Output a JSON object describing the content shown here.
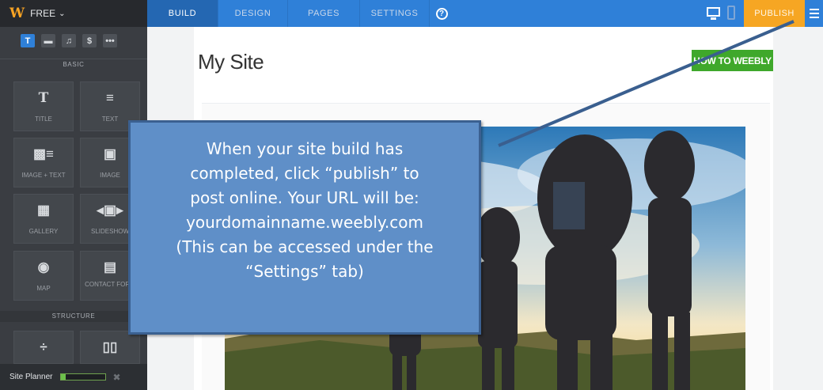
{
  "brand": {
    "plan_label": "FREE",
    "logo": "W",
    "menu_icon": "chevron-down-icon"
  },
  "nav": {
    "tabs": [
      {
        "label": "BUILD",
        "active": true
      },
      {
        "label": "DESIGN",
        "active": false
      },
      {
        "label": "PAGES",
        "active": false
      },
      {
        "label": "SETTINGS",
        "active": false
      }
    ],
    "help_glyph": "?",
    "publish_label": "PUBLISH"
  },
  "colors": {
    "accent": "#2f80d8",
    "publish": "#f6a623",
    "howto": "#3fa82b",
    "callout": "#5f8fc8"
  },
  "sidebar": {
    "categories": [
      {
        "glyph": "T",
        "icon": "text-category-icon",
        "active": true
      },
      {
        "glyph": "▬",
        "icon": "structure-category-icon",
        "active": false
      },
      {
        "glyph": "♫",
        "icon": "media-category-icon",
        "active": false
      },
      {
        "glyph": "$",
        "icon": "commerce-category-icon",
        "active": false
      },
      {
        "glyph": "•••",
        "icon": "more-category-icon",
        "active": false
      }
    ],
    "basic_label": "BASIC",
    "structure_label": "STRUCTURE",
    "elements": {
      "title": "TITLE",
      "text": "TEXT",
      "image_text": "IMAGE + TEXT",
      "image": "IMAGE",
      "gallery": "GALLERY",
      "slideshow": "SLIDESHOW",
      "map": "MAP",
      "contact_form": "CONTACT FORM"
    },
    "site_planner_label": "Site Planner",
    "site_planner_progress": 0.1
  },
  "site": {
    "title": "My Site",
    "nav_link": "HOW TO WEEBLY"
  },
  "callout": {
    "lines": [
      "When your site build has",
      "completed, click “publish” to",
      "post online.  Your URL will be:",
      "yourdomainname.weebly.com",
      "(This can be accessed under the",
      "“Settings” tab)"
    ]
  }
}
